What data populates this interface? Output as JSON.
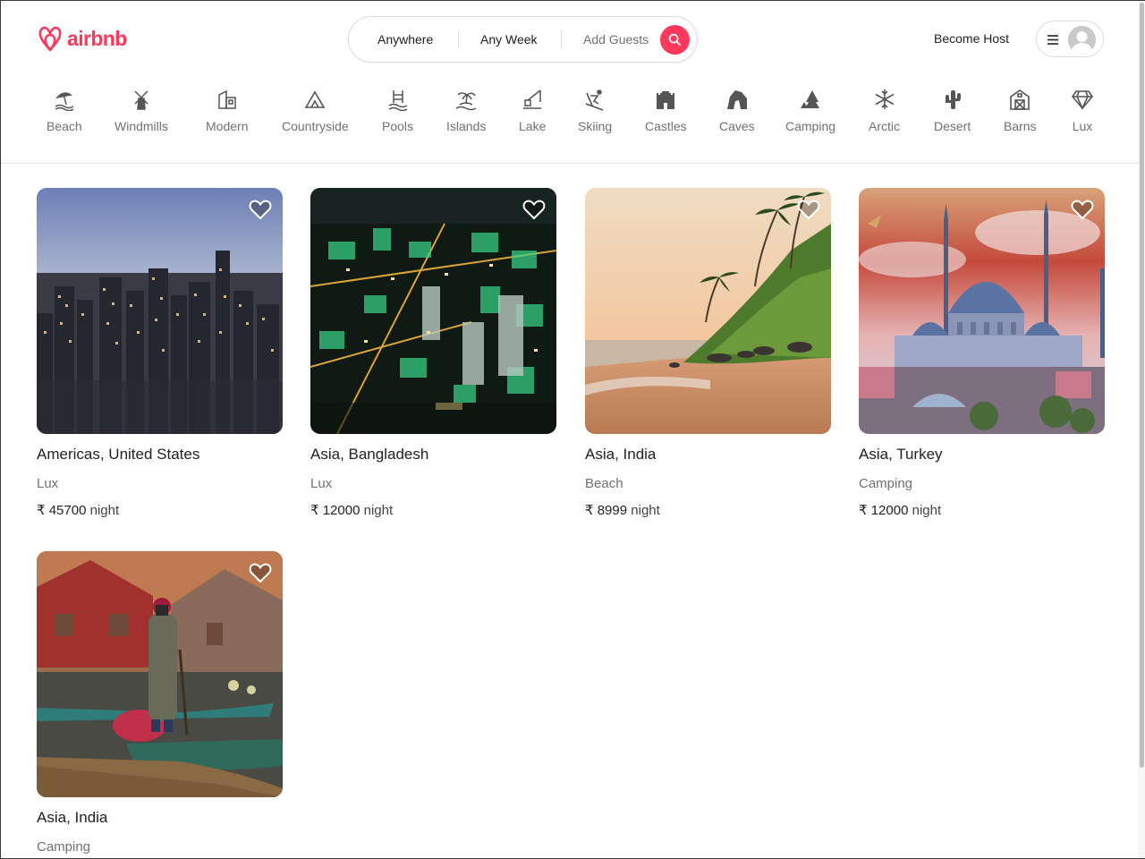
{
  "brand": {
    "name": "airbnb",
    "color": "#ff385c"
  },
  "search": {
    "anywhere": "Anywhere",
    "any_week": "Any Week",
    "add_guests": "Add Guests"
  },
  "header": {
    "become_host": "Become Host",
    "menu_icon": "hamburger-icon",
    "avatar_icon": "user-avatar-icon"
  },
  "categories": [
    {
      "label": "Beach",
      "icon": "beach-umbrella-icon"
    },
    {
      "label": "Windmills",
      "icon": "windmill-icon"
    },
    {
      "label": "Modern",
      "icon": "modern-building-icon"
    },
    {
      "label": "Countryside",
      "icon": "countryside-icon"
    },
    {
      "label": "Pools",
      "icon": "pool-icon"
    },
    {
      "label": "Islands",
      "icon": "island-icon"
    },
    {
      "label": "Lake",
      "icon": "lake-fishing-icon"
    },
    {
      "label": "Skiing",
      "icon": "skiing-icon"
    },
    {
      "label": "Castles",
      "icon": "castle-icon"
    },
    {
      "label": "Caves",
      "icon": "cave-icon"
    },
    {
      "label": "Camping",
      "icon": "camping-icon"
    },
    {
      "label": "Arctic",
      "icon": "snowflake-icon"
    },
    {
      "label": "Desert",
      "icon": "cactus-icon"
    },
    {
      "label": "Barns",
      "icon": "barn-icon"
    },
    {
      "label": "Lux",
      "icon": "diamond-icon"
    }
  ],
  "listings": [
    {
      "location": "Americas, United States",
      "category": "Lux",
      "currency": "₹",
      "price": "45700",
      "unit": "night",
      "photo": "city-skyline-dusk"
    },
    {
      "location": "Asia, Bangladesh",
      "category": "Lux",
      "currency": "₹",
      "price": "12000",
      "unit": "night",
      "photo": "city-night-lights"
    },
    {
      "location": "Asia, India",
      "category": "Beach",
      "currency": "₹",
      "price": "8999",
      "unit": "night",
      "photo": "beach-palm-cliff"
    },
    {
      "location": "Asia, Turkey",
      "category": "Camping",
      "currency": "₹",
      "price": "12000",
      "unit": "night",
      "photo": "mosque-sunset"
    },
    {
      "location": "Asia, India",
      "category": "Camping",
      "currency": "₹",
      "price": "",
      "unit": "",
      "photo": "lake-boats"
    }
  ]
}
